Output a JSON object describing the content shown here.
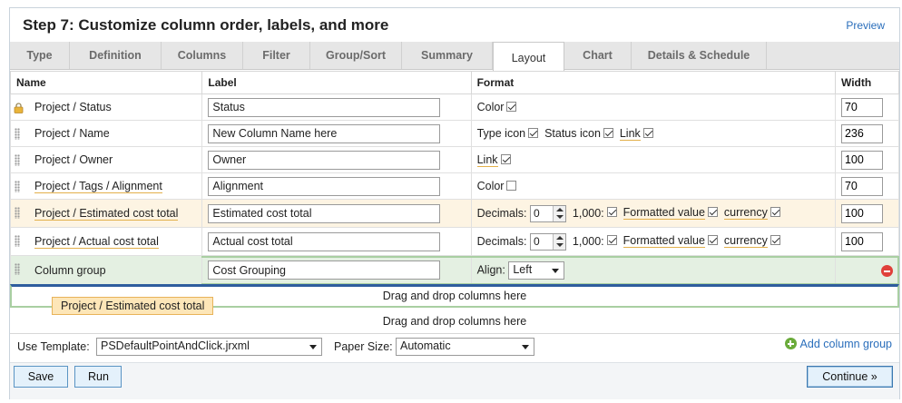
{
  "header": {
    "title": "Step 7: Customize column order, labels, and more",
    "preview_label": "Preview"
  },
  "tabs": [
    {
      "label": "Type",
      "active": false
    },
    {
      "label": "Definition",
      "active": false
    },
    {
      "label": "Columns",
      "active": false
    },
    {
      "label": "Filter",
      "active": false
    },
    {
      "label": "Group/Sort",
      "active": false
    },
    {
      "label": "Summary",
      "active": false
    },
    {
      "label": "Layout",
      "active": true
    },
    {
      "label": "Chart",
      "active": false
    },
    {
      "label": "Details & Schedule",
      "active": false
    }
  ],
  "table": {
    "headers": {
      "name": "Name",
      "label": "Label",
      "format": "Format",
      "width": "Width"
    },
    "rows": [
      {
        "name": "Project / Status",
        "label": "Status",
        "width": "70",
        "format": {
          "color_label": "Color",
          "color": true
        }
      },
      {
        "name": "Project / Name",
        "label": "New Column Name here",
        "width": "236",
        "format": {
          "type_icon_label": "Type icon",
          "type_icon": true,
          "status_icon_label": "Status icon",
          "status_icon": true,
          "link_label": "Link",
          "link": true
        }
      },
      {
        "name": "Project / Owner",
        "label": "Owner",
        "width": "100",
        "format": {
          "link_label": "Link",
          "link": true
        }
      },
      {
        "name": "Project / Tags / Alignment",
        "label": "Alignment",
        "width": "70",
        "format": {
          "color_label": "Color",
          "color": false
        }
      },
      {
        "name": "Project / Estimated cost total",
        "label": "Estimated cost total",
        "width": "100",
        "format": {
          "decimals_label": "Decimals:",
          "decimals": "0",
          "thousands_label": "1,000:",
          "thousands": true,
          "formatted_label": "Formatted value",
          "formatted": true,
          "currency_label": "currency",
          "currency": true
        }
      },
      {
        "name": "Project / Actual cost total",
        "label": "Actual cost total",
        "width": "100",
        "format": {
          "decimals_label": "Decimals:",
          "decimals": "0",
          "thousands_label": "1,000:",
          "thousands": true,
          "formatted_label": "Formatted value",
          "formatted": true,
          "currency_label": "currency",
          "currency": true
        }
      },
      {
        "name": "Column group",
        "label": "Cost Grouping",
        "format": {
          "align_label": "Align:",
          "align": "Left"
        }
      }
    ]
  },
  "drop_zones": {
    "zone1": "Drag and drop columns here",
    "zone2": "Drag and drop columns here",
    "dragging_chip": "Project / Estimated cost total"
  },
  "options": {
    "template_label": "Use Template:",
    "template_value": "PSDefaultPointAndClick.jrxml",
    "paper_label": "Paper Size:",
    "paper_value": "Automatic",
    "add_group_label": "Add column group"
  },
  "buttons": {
    "save": "Save",
    "run": "Run",
    "continue": "Continue »"
  },
  "colors": {
    "accent": "#2a6ebb",
    "highlight_row": "#fdf4e3",
    "group_row": "#e4f0e2",
    "remove": "#e0403a",
    "add": "#6aab3a"
  }
}
